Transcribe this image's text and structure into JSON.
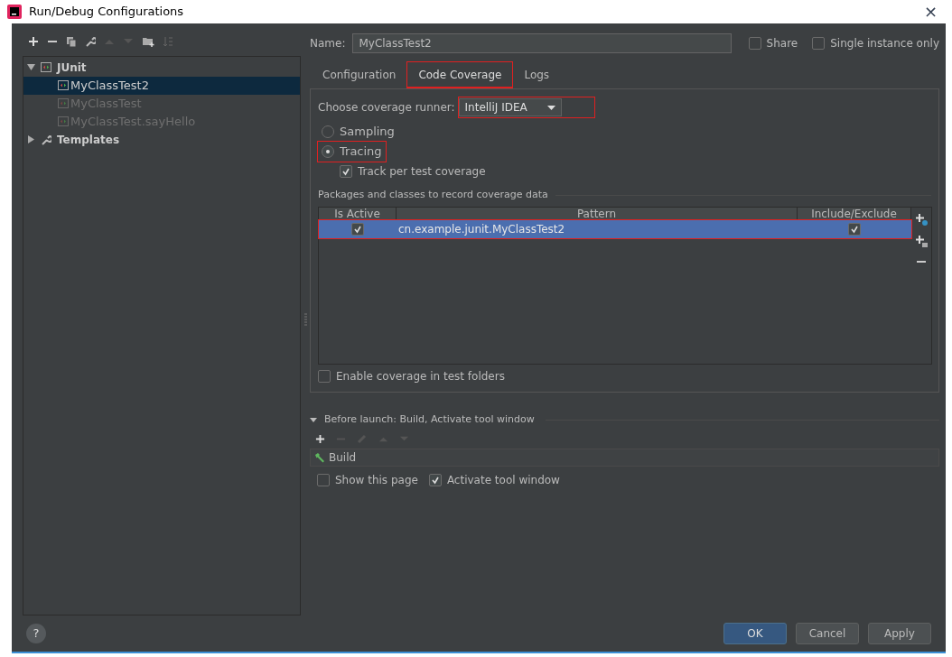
{
  "window": {
    "title": "Run/Debug Configurations",
    "close": "×"
  },
  "tree": [
    {
      "label": "JUnit",
      "expanded": true,
      "children": [
        {
          "label": "MyClassTest2",
          "selected": true,
          "dimmed": false
        },
        {
          "label": "MyClassTest",
          "selected": false,
          "dimmed": true
        },
        {
          "label": "MyClassTest.sayHello",
          "selected": false,
          "dimmed": true
        }
      ]
    },
    {
      "label": "Templates",
      "expanded": false
    }
  ],
  "name_field": {
    "label": "Name:",
    "value": "MyClassTest2"
  },
  "share": {
    "label": "Share",
    "checked": false
  },
  "single_instance": {
    "label": "Single instance only",
    "checked": false
  },
  "tabs": [
    {
      "label": "Configuration",
      "selected": false,
      "highlighted": false
    },
    {
      "label": "Code Coverage",
      "selected": true,
      "highlighted": true
    },
    {
      "label": "Logs",
      "selected": false,
      "highlighted": false
    }
  ],
  "runner": {
    "label": "Choose coverage runner:",
    "value": "IntelliJ IDEA",
    "highlighted": true
  },
  "modes": [
    {
      "label": "Sampling",
      "selected": false,
      "highlighted": false
    },
    {
      "label": "Tracing",
      "selected": true,
      "highlighted": true
    }
  ],
  "track_per_test": {
    "label": "Track per test coverage",
    "checked": true
  },
  "packages": {
    "title": "Packages and classes to record coverage data",
    "columns": [
      "Is Active",
      "Pattern",
      "Include/Exclude"
    ],
    "rows": [
      {
        "active": true,
        "pattern": "cn.example.junit.MyClassTest2",
        "include": true,
        "selected": true,
        "highlighted": true
      }
    ]
  },
  "enable_test_folders": {
    "label": "Enable coverage in test folders",
    "checked": false
  },
  "before_launch": {
    "title": "Before launch: Build, Activate tool window",
    "expanded": true,
    "tasks": [
      "Build"
    ]
  },
  "show_page": {
    "label": "Show this page",
    "checked": false
  },
  "activate_tool": {
    "label": "Activate tool window",
    "checked": true
  },
  "help": "?",
  "buttons": [
    {
      "label": "OK",
      "kind": "primary"
    },
    {
      "label": "Cancel",
      "kind": "normal"
    },
    {
      "label": "Apply",
      "kind": "normal"
    }
  ]
}
